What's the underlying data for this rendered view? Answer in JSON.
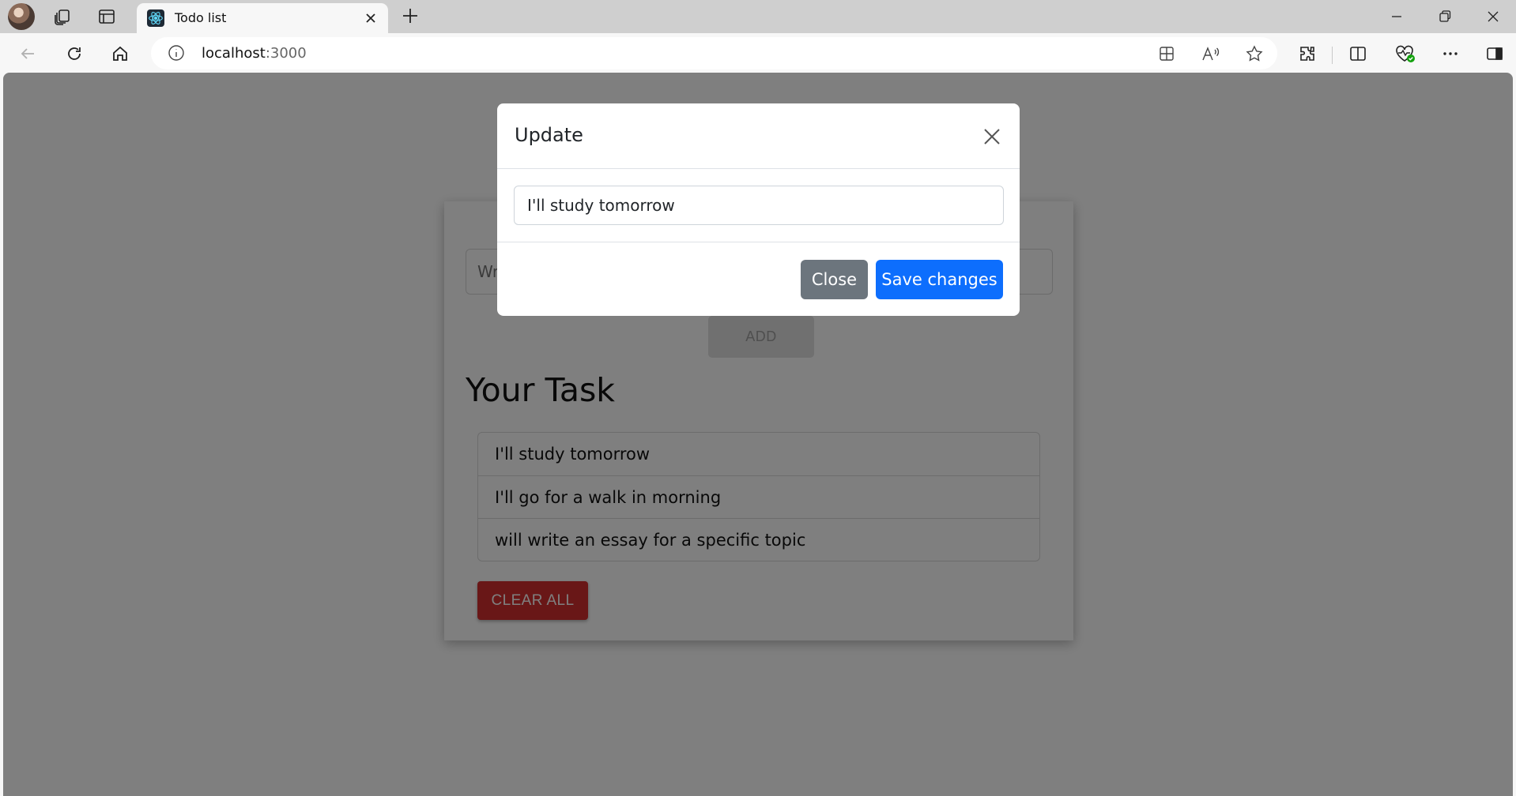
{
  "browser": {
    "tab_title": "Todo list",
    "url_host": "localhost",
    "url_port": ":3000",
    "icons": {
      "profile": "profile-avatar",
      "workspaces": "workspaces-icon",
      "tab_actions": "tab-actions-icon",
      "favicon": "react-icon",
      "tab_close": "close-icon",
      "new_tab": "plus-icon",
      "back": "back-arrow-icon",
      "refresh": "refresh-icon",
      "home": "home-icon",
      "site_info": "info-icon",
      "app_available": "app-available-icon",
      "read_aloud": "read-aloud-icon",
      "favorite": "star-icon",
      "extensions": "puzzle-icon",
      "split_screen": "split-screen-icon",
      "browser_essentials": "heart-pulse-icon",
      "more": "ellipsis-icon",
      "sidebar": "sidebar-icon"
    }
  },
  "app": {
    "input_placeholder": "Write your task here",
    "add_label": "ADD",
    "section_title": "Your Task",
    "tasks": [
      "I'll study tomorrow",
      "I'll go for a walk in morning",
      "will write an essay for a specific topic"
    ],
    "clear_label": "CLEAR ALL",
    "colors": {
      "clear_button": "#d32f2f",
      "save_button": "#0d6efd",
      "close_button": "#6c757d"
    }
  },
  "modal": {
    "title": "Update",
    "input_value": "I'll study tomorrow",
    "close_label": "Close",
    "save_label": "Save changes"
  }
}
